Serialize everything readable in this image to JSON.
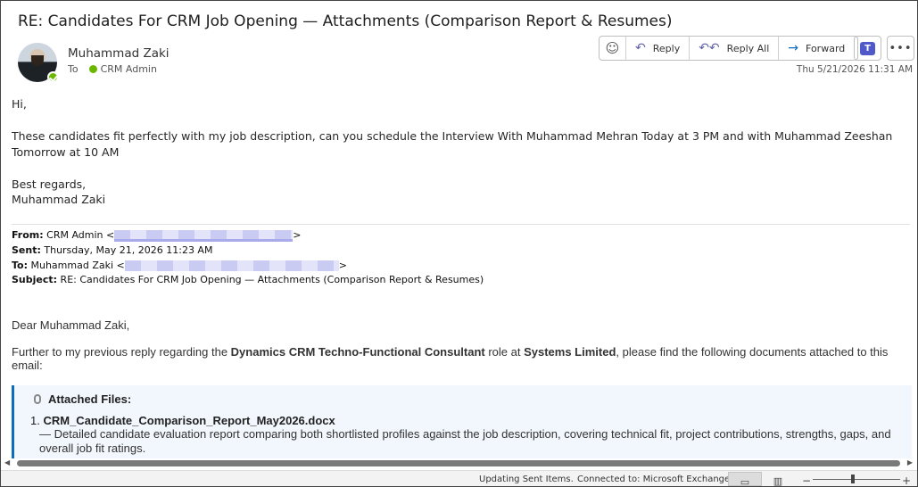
{
  "email": {
    "subject": "RE: Candidates For CRM Job Opening — Attachments (Comparison Report & Resumes)",
    "sender": "Muhammad Zaki",
    "to_label": "To",
    "to_name": "CRM Admin",
    "date": "Thu 5/21/2026 11:31 AM"
  },
  "actions": {
    "reply": "Reply",
    "reply_all": "Reply All",
    "forward": "Forward",
    "more": "•••"
  },
  "message": {
    "greeting": "Hi,",
    "para1": "These candidates fit perfectly with my job description, can you schedule the Interview With Muhammad Mehran Today at 3 PM and with Muhammad Zeeshan Tomorrow at 10 AM",
    "regards": "Best regards,",
    "signature": "Muhammad Zaki"
  },
  "quoted_header": {
    "from_label": "From:",
    "from_value": "CRM Admin <",
    "from_close": ">",
    "sent_label": "Sent:",
    "sent_value": "Thursday, May 21, 2026 11:23 AM",
    "to_label": "To:",
    "to_value": "Muhammad Zaki <",
    "to_close": ">",
    "subject_label": "Subject:",
    "subject_value": "RE: Candidates For CRM Job Opening — Attachments (Comparison Report & Resumes)"
  },
  "quoted_body": {
    "greeting": "Dear Muhammad Zaki,",
    "intro_pre": "Further to my previous reply regarding the ",
    "role": "Dynamics CRM Techno-Functional Consultant",
    "intro_mid": " role at ",
    "company": "Systems Limited",
    "intro_post": ", please find the following documents attached to this email:",
    "attached_title": "Attached Files:",
    "item1_num": "1. ",
    "item1_name": "CRM_Candidate_Comparison_Report_May2026.docx",
    "item1_desc": "— Detailed candidate evaluation report comparing both shortlisted profiles against the job description, covering technical fit, project contributions, strengths, gaps, and overall job fit ratings."
  },
  "status_bar": {
    "updating": "Updating Sent Items.",
    "connected": "Connected to: Microsoft Exchange",
    "zoom_minus": "−",
    "zoom_plus": "+"
  },
  "colors": {
    "accent": "#0f6cbd",
    "presence": "#6bb700",
    "icon": "#6264a7"
  }
}
